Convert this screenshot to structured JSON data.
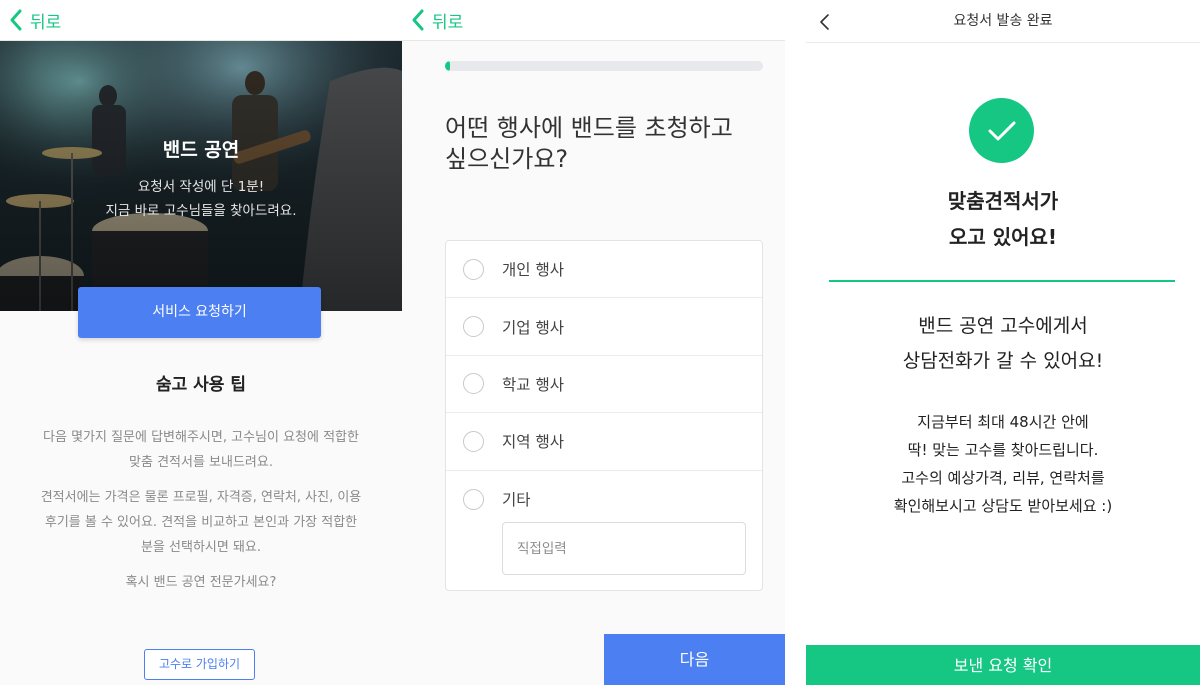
{
  "panel1": {
    "back_label": "뒤로",
    "hero": {
      "title": "밴드 공연",
      "subtitle_line1": "요청서 작성에 단 1분!",
      "subtitle_line2": "지금 바로 고수님들을 찾아드려요."
    },
    "request_button": "서비스 요청하기",
    "tips": {
      "title": "숨고 사용 팁",
      "para1_line1": "다음 몇가지 질문에 답변해주시면, 고수님이 요청에 적합한",
      "para1_line2": "맞춤 견적서를 보내드려요.",
      "para2_line1": "견적서에는 가격은 물론 프로필, 자격증, 연락처, 사진, 이용",
      "para2_line2": "후기를 볼 수 있어요. 견적을 비교하고 본인과 가장 적합한",
      "para2_line3": "분을 선택하시면 돼요.",
      "para3": "혹시 밴드 공연 전문가세요?"
    },
    "join_button": "고수로 가입하기"
  },
  "panel2": {
    "back_label": "뒤로",
    "progress_fraction": 0.01,
    "question_line1": "어떤 행사에 밴드를 초청하고",
    "question_line2": "싶으신가요?",
    "options": [
      {
        "label": "개인 행사"
      },
      {
        "label": "기업 행사"
      },
      {
        "label": "학교 행사"
      },
      {
        "label": "지역 행사"
      },
      {
        "label": "기타"
      }
    ],
    "direct_input_placeholder": "직접입력",
    "next_button": "다음"
  },
  "panel3": {
    "header_title": "요청서 발송 완료",
    "done_title_line1": "맞춤견적서가",
    "done_title_line2": "오고 있어요!",
    "sub_line1": "밴드 공연 고수에게서",
    "sub_line2": "상담전화가 갈 수 있어요!",
    "body_line1": "지금부터 최대 48시간 안에",
    "body_line2": "딱! 맞는 고수를 찾아드립니다.",
    "body_line3": "고수의 예상가격, 리뷰, 연락처를",
    "body_line4": "확인해보시고 상담도 받아보세요 :)",
    "confirm_button": "보낸 요청 확인"
  },
  "colors": {
    "brand_green": "#16c784",
    "primary_blue": "#4c7ff2"
  },
  "icons": {
    "back": "chevron-left-icon",
    "check": "check-icon",
    "radio": "radio-empty-icon"
  }
}
